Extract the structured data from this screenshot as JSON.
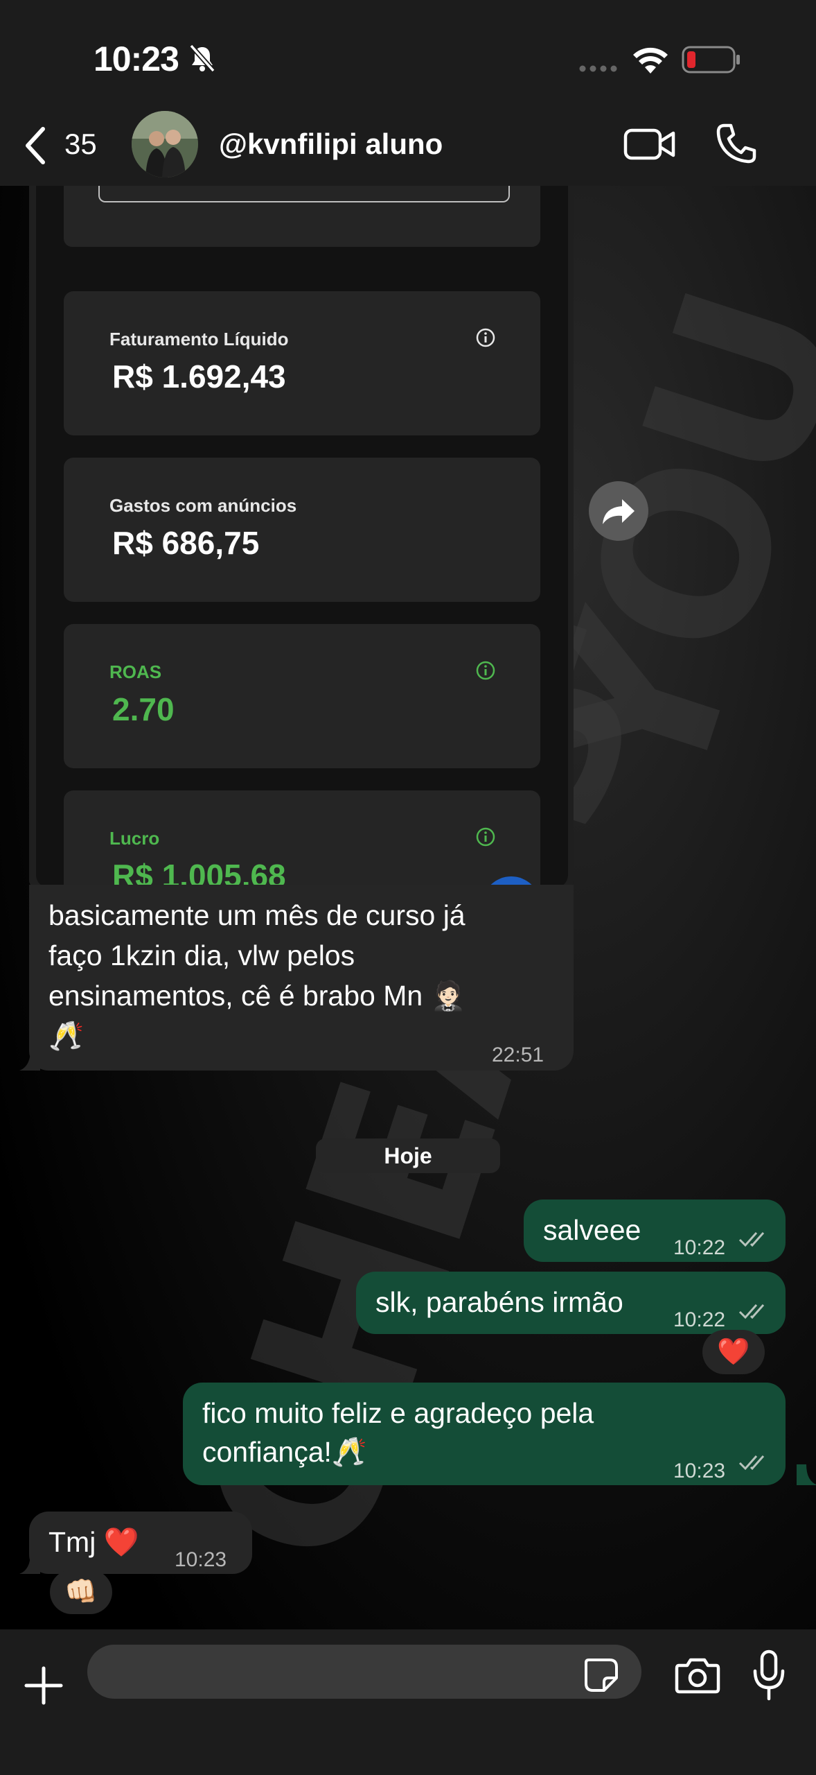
{
  "status_bar": {
    "time": "10:23"
  },
  "header": {
    "back_count": "35",
    "contact_name": "@kvnfilipi aluno"
  },
  "wallpaper": {
    "words": [
      "YOU",
      "ARE",
      "CHEATS"
    ]
  },
  "dashboard": {
    "cards": [
      {
        "label": "Faturamento Líquido",
        "value": "R$ 1.692,43",
        "info": true,
        "color": "white"
      },
      {
        "label": "Gastos com anúncios",
        "value": "R$ 686,75",
        "info": false,
        "color": "white"
      },
      {
        "label": "ROAS",
        "value": "2.70",
        "info": true,
        "color": "#4fb84f"
      },
      {
        "label": "Lucro",
        "value": "R$ 1.005,68",
        "info": true,
        "color": "#4fb84f"
      }
    ]
  },
  "messages": {
    "incoming_caption": {
      "text_line1": "basicamente um mês de curso  já",
      "text_line2": "faço 1kzin dia, vlw pelos",
      "text_line3": "ensinamentos, cê é brabo Mn 🤵🏻",
      "text_line4": "🥂",
      "time": "22:51"
    },
    "date_separator": "Hoje",
    "out1": {
      "text": "salveee",
      "time": "10:22"
    },
    "out2": {
      "text": "slk, parabéns irmão",
      "time": "10:22",
      "reaction": "❤️"
    },
    "out3": {
      "text_line1": "fico muito feliz e agradeço pela",
      "text_line2": "confiança!🥂",
      "time": "10:23"
    },
    "in_last": {
      "text": "Tmj ❤️",
      "time": "10:23",
      "reaction": "👊🏻"
    }
  },
  "input": {
    "placeholder": ""
  },
  "colors": {
    "outgoing_bubble": "#144d37",
    "incoming_bubble": "#262626",
    "positive_green": "#4fb84f",
    "battery_low": "#e0262d"
  }
}
